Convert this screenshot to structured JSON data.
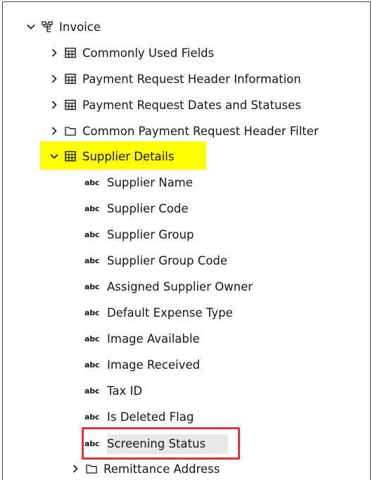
{
  "tree": {
    "root": {
      "label": "Invoice",
      "icon": "hierarchy-icon",
      "expanded": true
    },
    "children": [
      {
        "label": "Commonly Used Fields",
        "icon": "table-icon",
        "expanded": false
      },
      {
        "label": "Payment Request Header Information",
        "icon": "table-icon",
        "expanded": false
      },
      {
        "label": "Payment Request Dates and Statuses",
        "icon": "table-icon",
        "expanded": false
      },
      {
        "label": "Common Payment Request Header Filter",
        "icon": "folder-icon",
        "expanded": false
      },
      {
        "label": "Supplier Details",
        "icon": "table-icon",
        "expanded": true,
        "highlight_color": "#ffff00"
      }
    ],
    "fields": [
      {
        "type": "abc",
        "label": "Supplier Name"
      },
      {
        "type": "abc",
        "label": "Supplier Code"
      },
      {
        "type": "abc",
        "label": "Supplier Group"
      },
      {
        "type": "abc",
        "label": "Supplier Group Code"
      },
      {
        "type": "abc",
        "label": "Assigned Supplier Owner"
      },
      {
        "type": "abc",
        "label": "Default Expense Type"
      },
      {
        "type": "abc",
        "label": "Image Available"
      },
      {
        "type": "abc",
        "label": "Image Received"
      },
      {
        "type": "abc",
        "label": "Tax ID"
      },
      {
        "type": "abc",
        "label": "Is Deleted Flag"
      },
      {
        "type": "abc",
        "label": "Screening Status",
        "selected": true,
        "outline_color": "#e2333a"
      }
    ],
    "after": {
      "label": "Remittance Address",
      "icon": "folder-icon",
      "expanded": false
    }
  }
}
